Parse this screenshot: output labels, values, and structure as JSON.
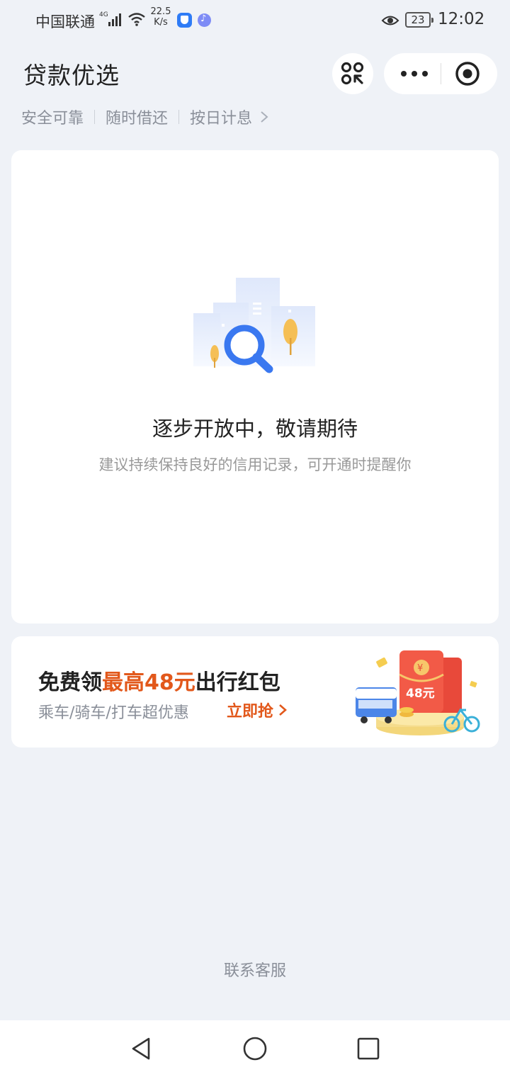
{
  "status_bar": {
    "carrier": "中国联通",
    "network": "4G",
    "speed_value": "22.5",
    "speed_unit": "K/s",
    "battery": "23",
    "time": "12:02"
  },
  "header": {
    "title": "贷款优选",
    "icons": [
      "scan-icon",
      "more-icon",
      "close-icon"
    ]
  },
  "tags": {
    "items": [
      "安全可靠",
      "随时借还",
      "按日计息"
    ],
    "chevron": "chevron-right-icon"
  },
  "empty_state": {
    "title": "逐步开放中，敬请期待",
    "subtitle": "建议持续保持良好的信用记录，可开通时提醒你",
    "illustration": "search-illustration"
  },
  "promo": {
    "title_prefix": "免费领",
    "title_highlight": "最高48元",
    "title_suffix": "出行红包",
    "subtitle": "乘车/骑车/打车超优惠",
    "cta": "立即抢",
    "badge_amount": "48元",
    "highlight_color": "#e2581b"
  },
  "footer": {
    "contact": "联系客服"
  },
  "nav": {
    "icons": [
      "back-icon",
      "home-icon",
      "recent-apps-icon"
    ]
  }
}
